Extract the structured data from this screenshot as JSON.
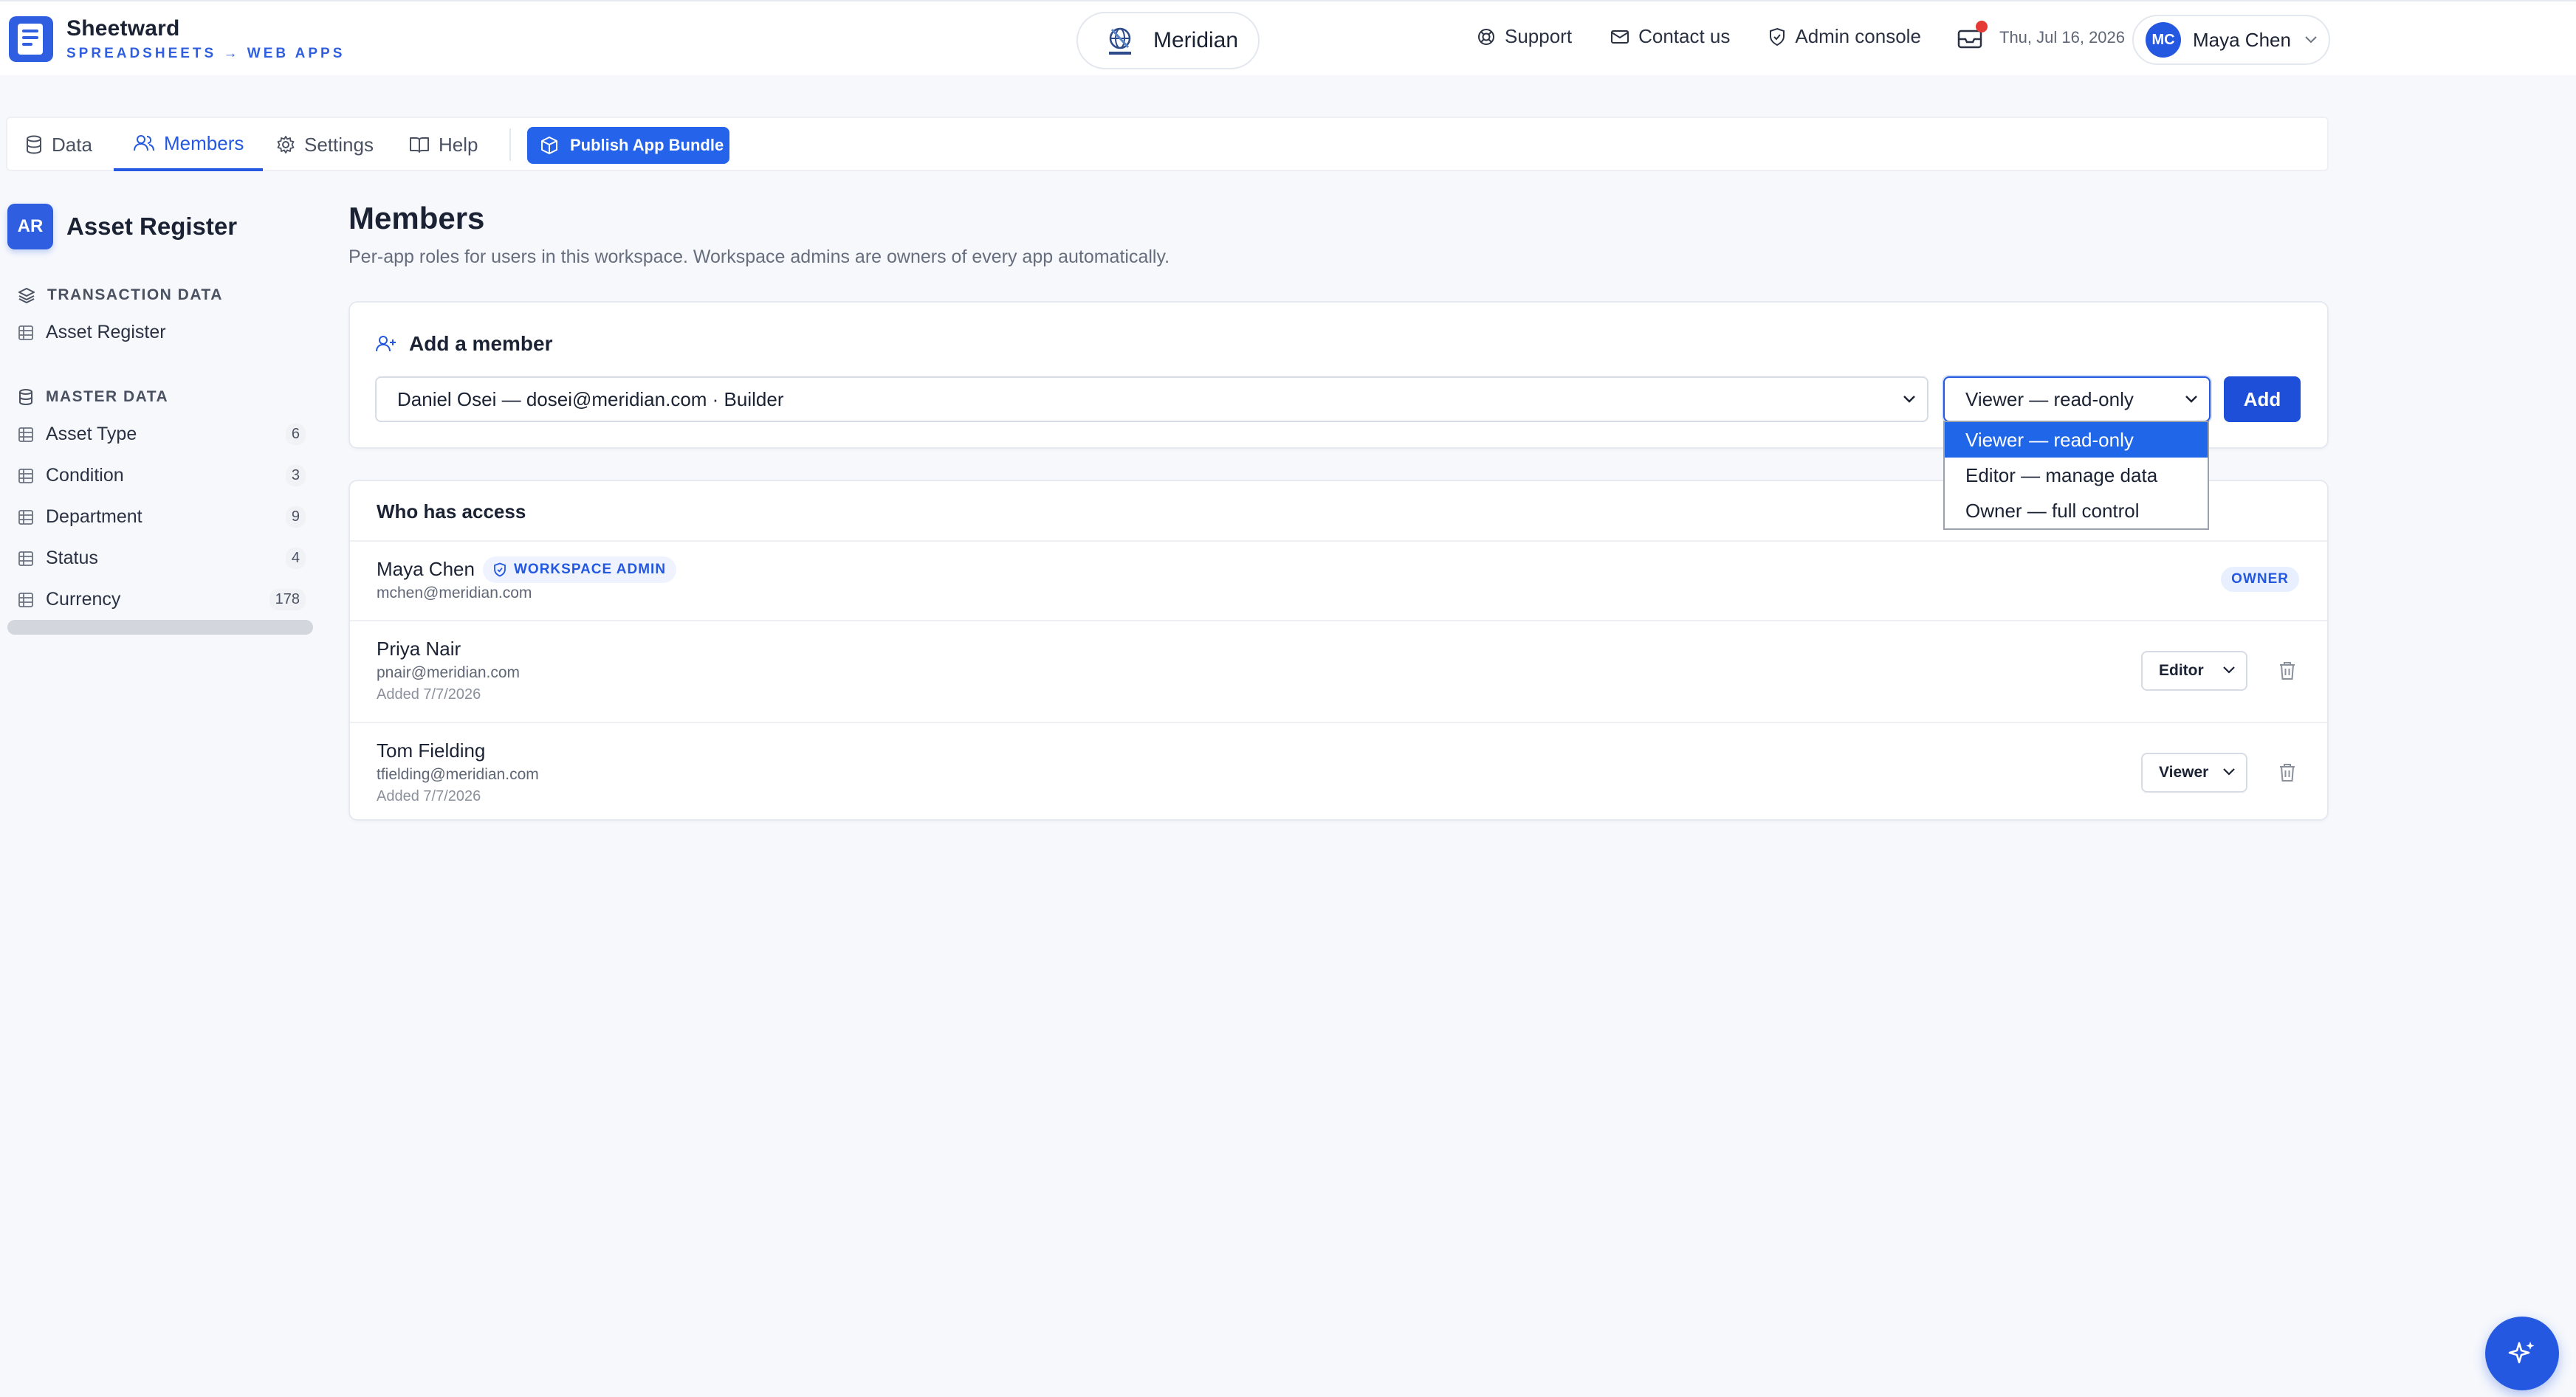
{
  "brand": {
    "name": "Sheetward",
    "tagline": "SPREADSHEETS → WEB APPS"
  },
  "tenant": {
    "name": "Meridian",
    "logo_icon": "meridian-globe-logo"
  },
  "header": {
    "links": [
      {
        "label": "Support",
        "icon": "lifebuoy-icon"
      },
      {
        "label": "Contact us",
        "icon": "mail-icon"
      },
      {
        "label": "Admin console",
        "icon": "shield-icon"
      }
    ],
    "inbox_icon": "inbox-icon",
    "has_notification": true,
    "date": "Thu, Jul 16, 2026",
    "user": {
      "initials": "MC",
      "name": "Maya Chen"
    }
  },
  "tabs": [
    {
      "label": "Data",
      "icon": "database-icon",
      "active": false
    },
    {
      "label": "Members",
      "icon": "users-icon",
      "active": true
    },
    {
      "label": "Settings",
      "icon": "gear-icon",
      "active": false
    },
    {
      "label": "Help",
      "icon": "book-icon",
      "active": false
    }
  ],
  "publish_label": "Publish App Bundle",
  "sidebar": {
    "app_badge": "AR",
    "app_name": "Asset Register",
    "sections": [
      {
        "title": "TRANSACTION DATA",
        "icon": "layers-icon",
        "items": [
          {
            "label": "Asset Register",
            "count": ""
          }
        ]
      },
      {
        "title": "MASTER DATA",
        "icon": "database-icon",
        "items": [
          {
            "label": "Asset Type",
            "count": "6"
          },
          {
            "label": "Condition",
            "count": "3"
          },
          {
            "label": "Department",
            "count": "9"
          },
          {
            "label": "Status",
            "count": "4"
          },
          {
            "label": "Currency",
            "count": "178"
          }
        ]
      }
    ]
  },
  "main": {
    "title": "Members",
    "subtitle": "Per-app roles for users in this workspace. Workspace admins are owners of every app automatically.",
    "add_member": {
      "heading": "Add a member",
      "selected_member": "Daniel Osei — dosei@meridian.com · Builder",
      "selected_role": "Viewer — read-only",
      "add_label": "Add",
      "role_options": [
        "Viewer — read-only",
        "Editor — manage data",
        "Owner — full control"
      ]
    },
    "access": {
      "heading": "Who has access",
      "members": [
        {
          "name": "Maya Chen",
          "email": "mchen@meridian.com",
          "badge": "WORKSPACE ADMIN",
          "role": "OWNER",
          "added": ""
        },
        {
          "name": "Priya Nair",
          "email": "pnair@meridian.com",
          "added": "Added 7/7/2026",
          "role": "Editor"
        },
        {
          "name": "Tom Fielding",
          "email": "tfielding@meridian.com",
          "added": "Added 7/7/2026",
          "role": "Viewer"
        }
      ]
    }
  },
  "colors": {
    "accent": "#2458e0",
    "brand": "#2f5fe0",
    "notification": "#e53935"
  }
}
